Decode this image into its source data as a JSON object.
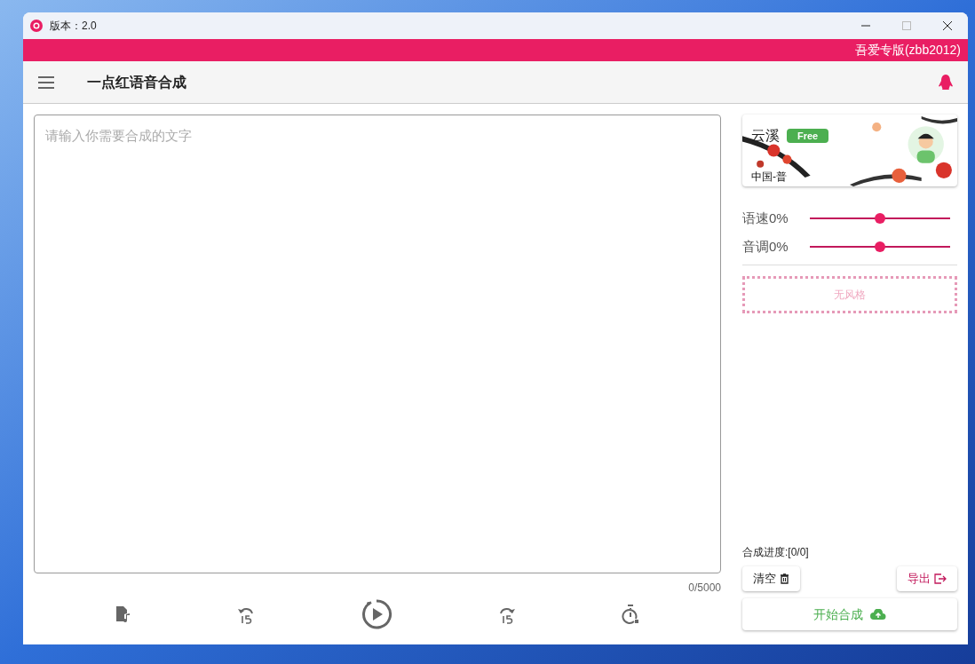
{
  "window": {
    "title": "版本：2.0"
  },
  "banner": {
    "text": "吾爱专版(zbb2012)"
  },
  "app_bar": {
    "title": "一点红语音合成"
  },
  "editor": {
    "placeholder": "请输入你需要合成的文字",
    "counter": "0/5000"
  },
  "voice": {
    "name": "云溪",
    "badge": "Free",
    "region": "中国-普"
  },
  "sliders": [
    {
      "label": "语速0%",
      "level": 0.5
    },
    {
      "label": "音调0%",
      "level": 0.5
    }
  ],
  "style_box": {
    "text": "无风格"
  },
  "progress": {
    "label": "合成进度:[0/0]"
  },
  "buttons": {
    "clear": "清空",
    "export": "导出",
    "start": "开始合成"
  }
}
